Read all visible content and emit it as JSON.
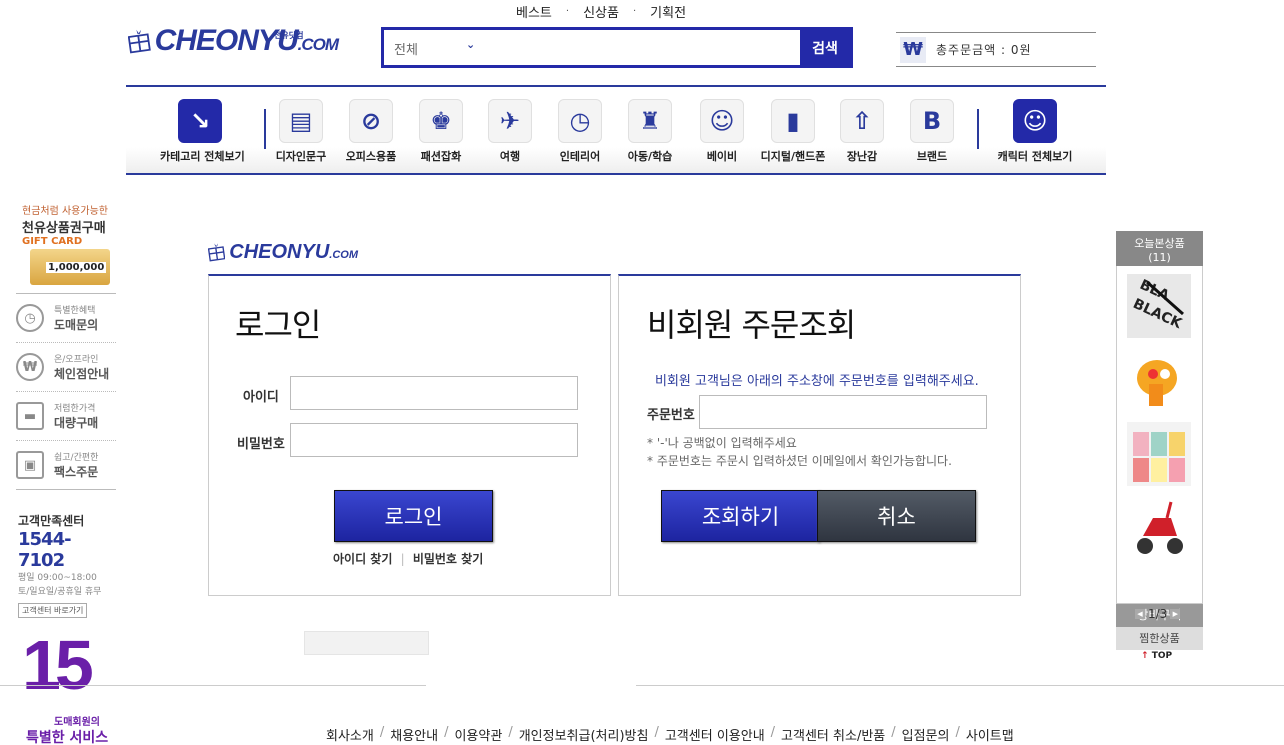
{
  "header": {
    "topnav": [
      "베스트",
      "신상품",
      "기획전"
    ],
    "topnav_sep": "·",
    "logo_text": "CHEONYU",
    "logo_suffix": ".COM",
    "logo_small": "천유닷컴",
    "search": {
      "category": "전체",
      "button": "검색"
    },
    "cart_total_label": "총주문금액 : 0원",
    "won_symbol": "₩"
  },
  "categories": [
    {
      "label": "카테고리 전체보기",
      "icon": "arrow-down-right-icon",
      "glyph": "↘"
    },
    {
      "label": "디자인문구",
      "icon": "notebook-icon",
      "glyph": "▤"
    },
    {
      "label": "오피스용품",
      "icon": "paperclip-icon",
      "glyph": "⊘"
    },
    {
      "label": "패션잡화",
      "icon": "tshirt-icon",
      "glyph": "♚"
    },
    {
      "label": "여행",
      "icon": "airplane-icon",
      "glyph": "✈"
    },
    {
      "label": "인테리어",
      "icon": "clock-icon",
      "glyph": "◷"
    },
    {
      "label": "아동/학습",
      "icon": "castle-icon",
      "glyph": "♜"
    },
    {
      "label": "베이비",
      "icon": "baby-icon",
      "glyph": "☺"
    },
    {
      "label": "디지털/핸드폰",
      "icon": "phone-icon",
      "glyph": "▮"
    },
    {
      "label": "장난감",
      "icon": "rocket-icon",
      "glyph": "⇧"
    },
    {
      "label": "브랜드",
      "icon": "brand-b-icon",
      "glyph": "B"
    },
    {
      "label": "캐릭터 전체보기",
      "icon": "smiley-icon",
      "glyph": "☺"
    }
  ],
  "left_sidebar": {
    "gift": {
      "line1": "현금처럼 사용가능한",
      "line2": "천유상품권구매",
      "line3": "GIFT CARD",
      "amount": "1,000,000"
    },
    "items": [
      {
        "small": "특별한혜택",
        "big": "도매문의",
        "icon": "clock-icon",
        "glyph": "◷"
      },
      {
        "small": "온/오프라인",
        "big": "체인점안내",
        "icon": "won-icon",
        "glyph": "₩"
      },
      {
        "small": "저렴한가격",
        "big": "대량구매",
        "icon": "truck-icon",
        "glyph": "▬"
      },
      {
        "small": "쉽고/간편한",
        "big": "팩스주문",
        "icon": "fax-icon",
        "glyph": "▣"
      }
    ],
    "cs": {
      "title": "고객만족센터",
      "phone": "1544-7102",
      "hours": "평일 09:00~18:00",
      "holiday": "토/일요일/공휴일 휴무",
      "button": "고객센터 바로가기"
    },
    "promo": {
      "number": "15",
      "sub": "도매회원의",
      "sub2": "특별한 서비스"
    }
  },
  "login": {
    "title": "로그인",
    "id_label": "아이디",
    "pw_label": "비밀번호",
    "button": "로그인",
    "find_id": "아이디 찾기",
    "find_pw": "비밀번호 찾기",
    "link_sep": "|"
  },
  "guest": {
    "title": "비회원 주문조회",
    "guide": "비회원 고객님은 아래의 주소창에 주문번호를 입력해주세요.",
    "order_label": "주문번호",
    "note1": "* '-'나 공백없이 입력해주세요",
    "note2": "* 주문번호는 주문시 입력하셨던 이메일에서 확인가능합니다.",
    "search_button": "조회하기",
    "cancel_button": "취소"
  },
  "right_sidebar": {
    "title": "오늘본상품",
    "count": "(11)",
    "page": "1/3",
    "prev": "◀",
    "next": "▶",
    "cart": "장바구니",
    "wish": "찜한상품",
    "top": "TOP",
    "top_arrow": "↑"
  },
  "footer": {
    "menu": [
      "회사소개",
      "채용안내",
      "이용약관",
      "개인정보취급(처리)방침",
      "고객센터 이용안내",
      "고객센터 취소/반품",
      "입점문의",
      "사이트맵"
    ],
    "menu_sep": "/"
  },
  "colors": {
    "brand": "#2a3a9c",
    "button_blue": "#2329a8",
    "promo": "#6a1fa8"
  }
}
